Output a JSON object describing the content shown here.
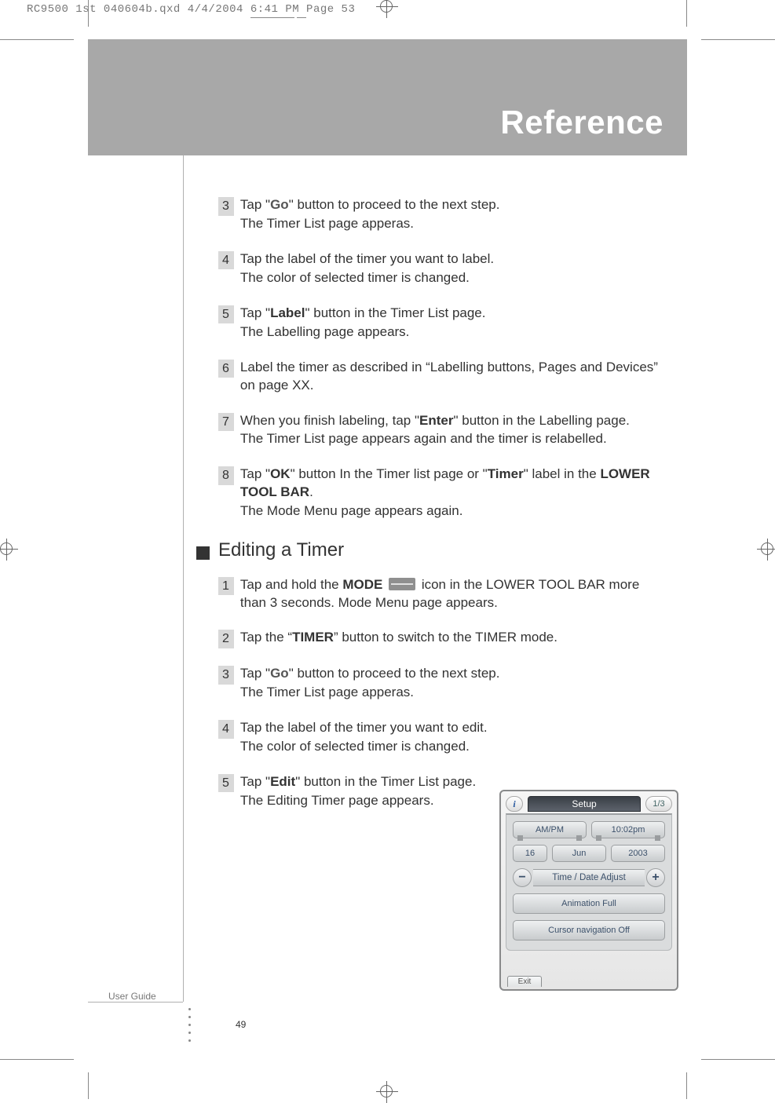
{
  "slugline": "RC9500 1st 040604b.qxd  4/4/2004  6:41 PM  Page 53",
  "header_title": "Reference",
  "user_guide_label": "User Guide",
  "page_number": "49",
  "steps_a": {
    "s3": {
      "num": "3",
      "line1_a": "Tap \"",
      "go": "Go",
      "line1_b": "\" button to proceed to the next step.",
      "line2": "The Timer List page apperas."
    },
    "s4": {
      "num": "4",
      "line1": "Tap the label of the timer you want to label.",
      "line2": "The color of selected timer is changed."
    },
    "s5": {
      "num": "5",
      "line1_a": "Tap \"",
      "label": "Label",
      "line1_b": "\" button in the Timer List page.",
      "line2": "The Labelling page appears."
    },
    "s6": {
      "num": "6",
      "line1": "Label the timer as described in “Labelling buttons, Pages and Devices” on page XX."
    },
    "s7": {
      "num": "7",
      "line1_a": "When you finish labeling, tap \"",
      "enter": "Enter",
      "line1_b": "\" button in the Labelling page.",
      "line2": "The Timer List page appears again and the timer is relabelled."
    },
    "s8": {
      "num": "8",
      "line1_a": "Tap \"",
      "ok": "OK",
      "line1_b": "\" button In the Timer list page or \"",
      "timer": "Timer",
      "line1_c": "\" label in the ",
      "bar": "LOWER TOOL BAR",
      "dot": ".",
      "line2": "The Mode Menu page appears again."
    }
  },
  "section_title": "Editing a Timer",
  "steps_b": {
    "s1": {
      "num": "1",
      "line1_a": "Tap and hold the ",
      "mode": "MODE",
      "line1_b": " icon in the LOWER TOOL BAR more than 3 seconds. Mode Menu page appears."
    },
    "s2": {
      "num": "2",
      "line1_a": "Tap the “",
      "timer": "TIMER",
      "line1_b": "” button to switch to the TIMER mode."
    },
    "s3": {
      "num": "3",
      "line1_a": "Tap \"",
      "go": "Go",
      "line1_b": "\" button to proceed to the next step.",
      "line2": "The Timer List page apperas."
    },
    "s4": {
      "num": "4",
      "line1": "Tap the label of the timer you want to edit.",
      "line2": "The color of selected timer is changed."
    },
    "s5": {
      "num": "5",
      "line1_a": "Tap \"",
      "edit": "Edit",
      "line1_b": "\" button in the Timer List page.",
      "line2": "The Editing Timer page appears."
    }
  },
  "device": {
    "info_glyph": "i",
    "setup": "Setup",
    "page_ind": "1/3",
    "ampm": "AM/PM",
    "time": "10:02pm",
    "day": "16",
    "month": "Jun",
    "year": "2003",
    "minus": "−",
    "plus": "+",
    "tda": "Time / Date Adjust",
    "anim": "Animation Full",
    "cursor": "Cursor navigation Off",
    "exit": "Exit"
  }
}
